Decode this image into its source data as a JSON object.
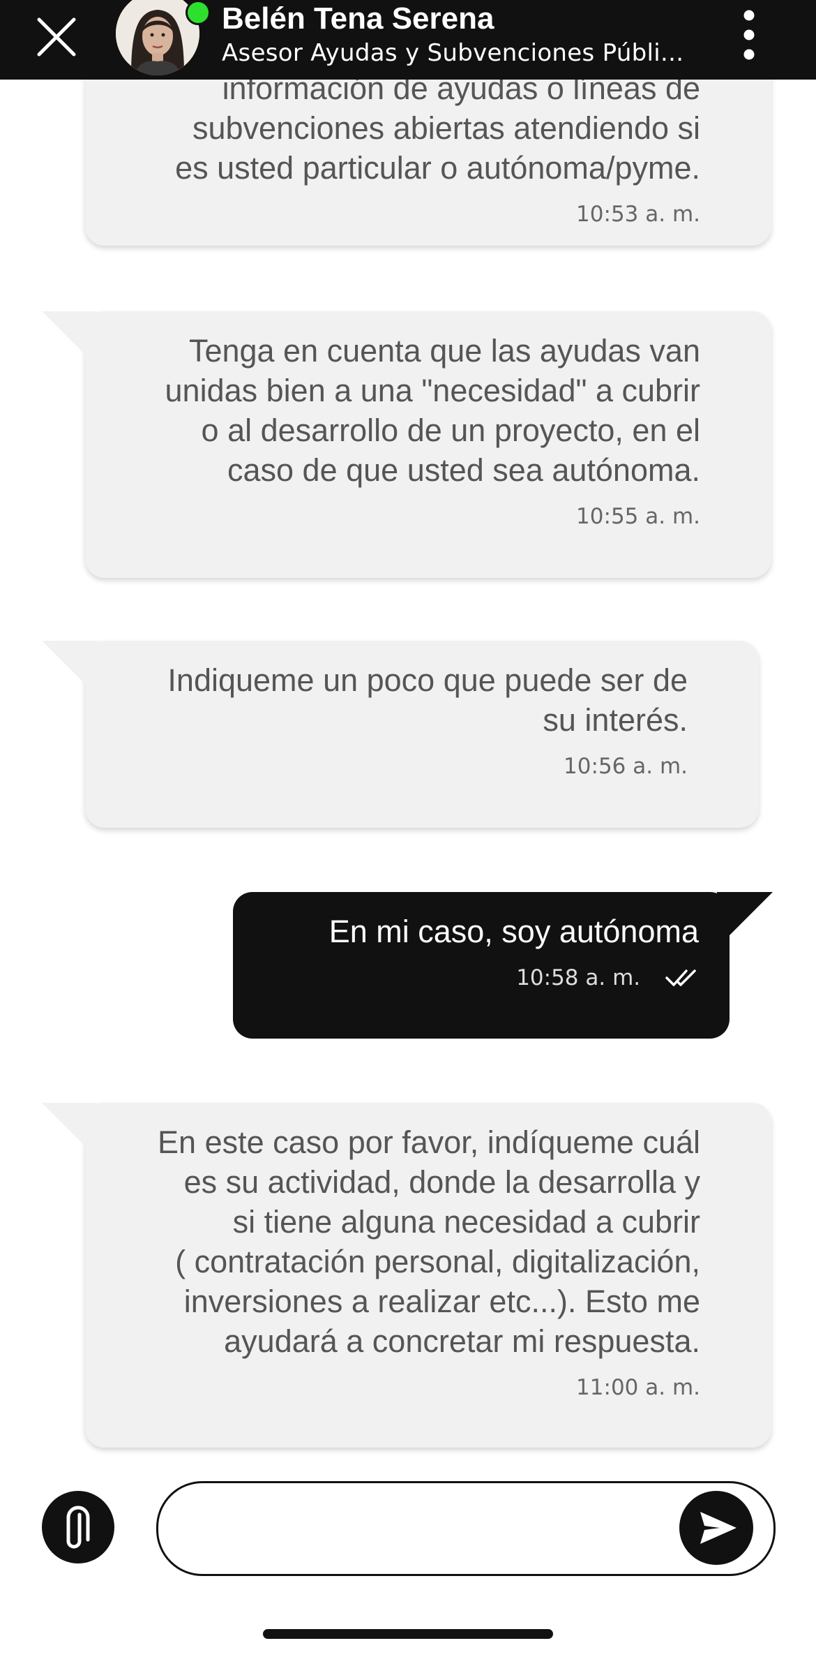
{
  "header": {
    "contact_name": "Belén Tena Serena",
    "contact_subtitle": "Asesor Ayudas y Subvenciones Públi...",
    "online_status_color": "#2ee02e"
  },
  "messages": [
    {
      "direction": "incoming",
      "text": "información de ayudas o líneas de\nsubvenciones abiertas atendiendo si\nes usted particular o autónoma/pyme.",
      "time": "10:53 a. m."
    },
    {
      "direction": "incoming",
      "text": "Tenga en cuenta que las ayudas van\nunidas bien a una \"necesidad\" a cubrir\no al desarrollo de un proyecto, en el\ncaso de que usted sea autónoma.",
      "time": "10:55 a. m."
    },
    {
      "direction": "incoming",
      "text": "Indiqueme un poco que puede ser de\nsu interés.",
      "time": "10:56 a. m."
    },
    {
      "direction": "outgoing",
      "text": "En mi caso, soy autónoma",
      "time": "10:58 a. m.",
      "status": "read"
    },
    {
      "direction": "incoming",
      "text": "En este caso por favor, indíqueme cuál\nes su actividad, donde la desarrolla  y\nsi tiene alguna necesidad a cubrir\n( contratación personal, digitalización,\ninversiones a realizar etc...). Esto me\nayudará a concretar mi respuesta.",
      "time": "11:00 a. m."
    }
  ],
  "composer": {
    "value": "",
    "placeholder": ""
  },
  "icons": {
    "close": "close-icon",
    "menu": "more-vertical-icon",
    "attach": "paperclip-icon",
    "send": "send-icon",
    "read_receipt": "double-check-icon"
  },
  "colors": {
    "header_bg": "#111111",
    "incoming_bubble": "#f1f1f1",
    "outgoing_bubble": "#111111"
  }
}
